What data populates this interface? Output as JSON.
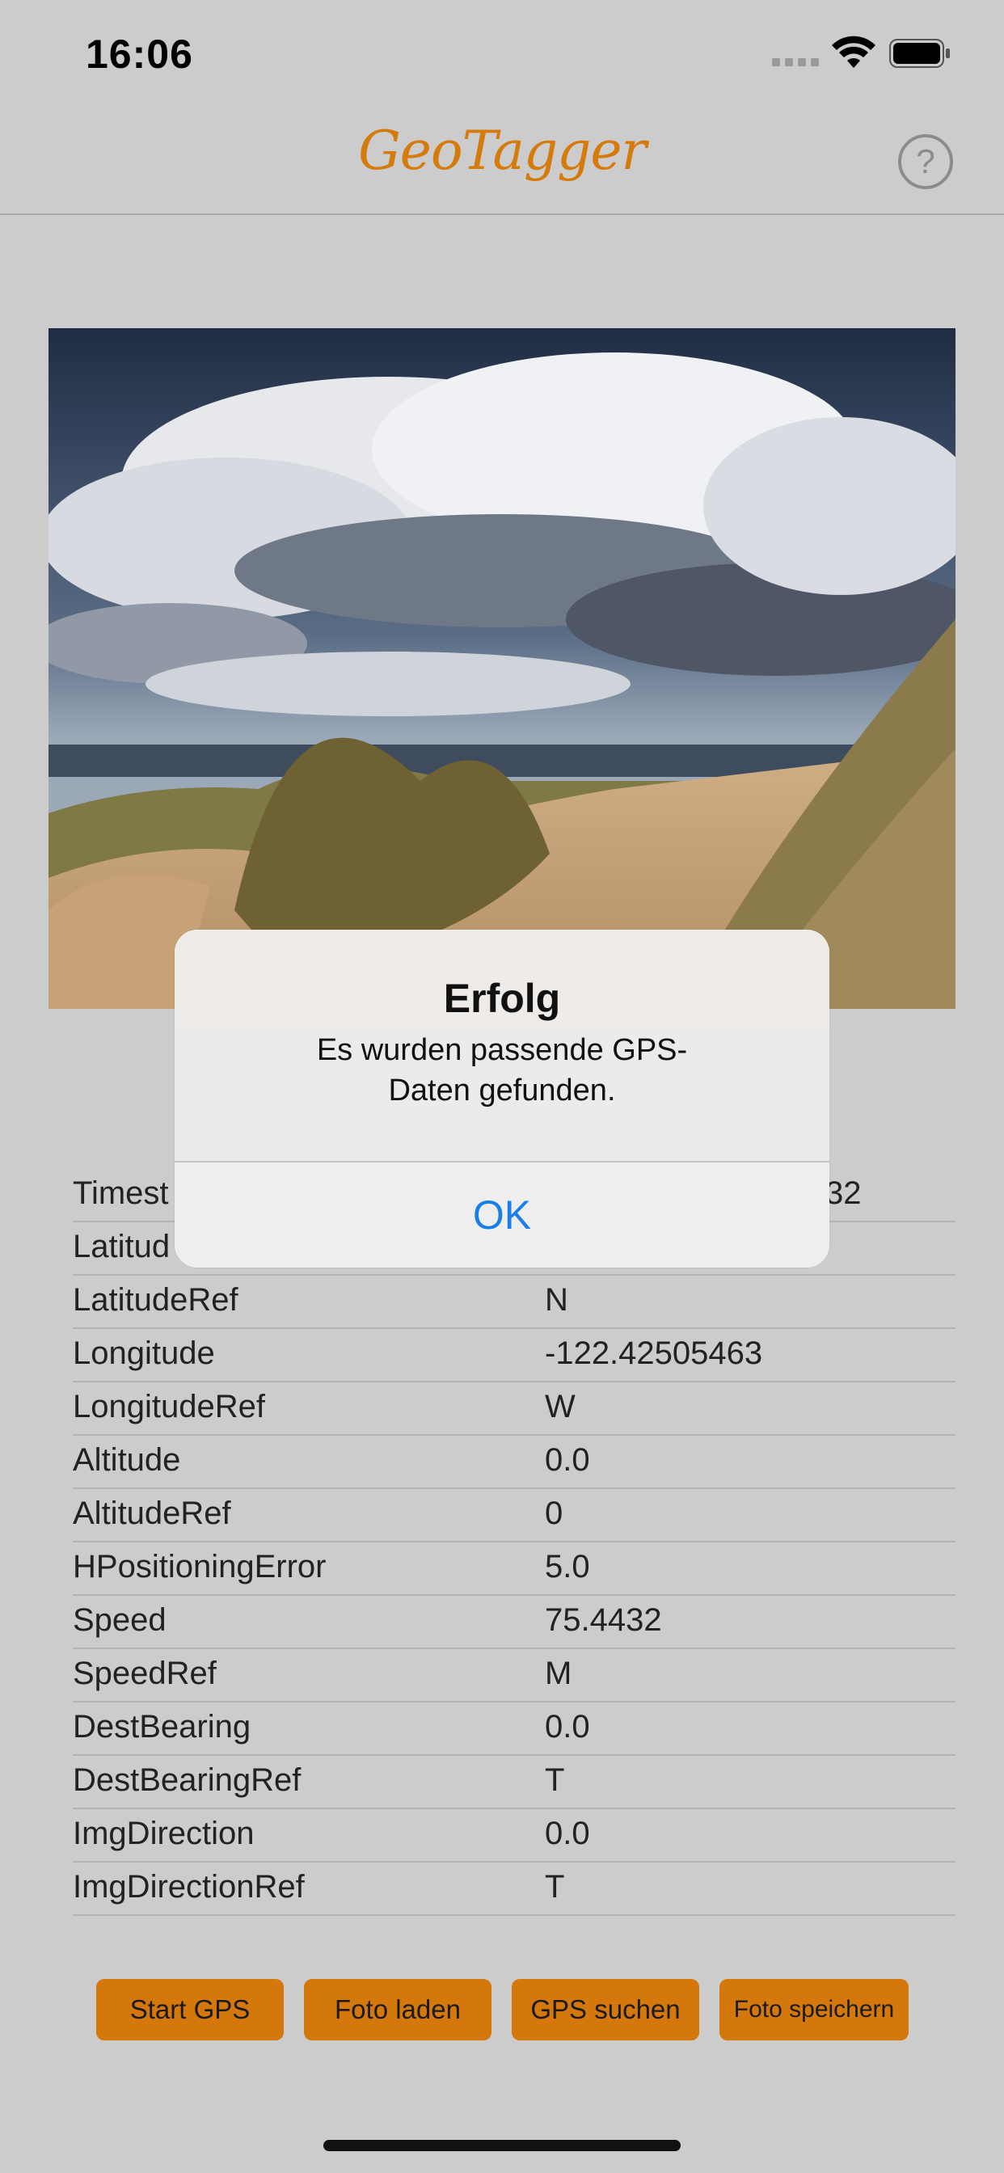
{
  "status_bar": {
    "time": "16:06"
  },
  "nav": {
    "title": "GeoTagger",
    "help_glyph": "?"
  },
  "table": {
    "rows": [
      {
        "key": "Timest",
        "value": "32"
      },
      {
        "key": "Latitud",
        "value": ""
      },
      {
        "key": "LatitudeRef",
        "value": "N"
      },
      {
        "key": "Longitude",
        "value": "-122.42505463"
      },
      {
        "key": "LongitudeRef",
        "value": "W"
      },
      {
        "key": "Altitude",
        "value": "0.0"
      },
      {
        "key": "AltitudeRef",
        "value": "0"
      },
      {
        "key": "HPositioningError",
        "value": "5.0"
      },
      {
        "key": "Speed",
        "value": "75.4432"
      },
      {
        "key": "SpeedRef",
        "value": "M"
      },
      {
        "key": "DestBearing",
        "value": "0.0"
      },
      {
        "key": "DestBearingRef",
        "value": "T"
      },
      {
        "key": "ImgDirection",
        "value": "0.0"
      },
      {
        "key": "ImgDirectionRef",
        "value": "T"
      }
    ]
  },
  "alert": {
    "title": "Erfolg",
    "message_line1": "Es wurden passende GPS-",
    "message_line2": "Daten gefunden.",
    "ok_label": "OK"
  },
  "buttons": {
    "start_gps": "Start GPS",
    "foto_laden": "Foto laden",
    "gps_suchen": "GPS suchen",
    "foto_speichern": "Foto speichern"
  },
  "colors": {
    "accent": "#d5780b",
    "title": "#d57b0c",
    "alert_button": "#1a7ee8",
    "background": "#cccccc"
  }
}
